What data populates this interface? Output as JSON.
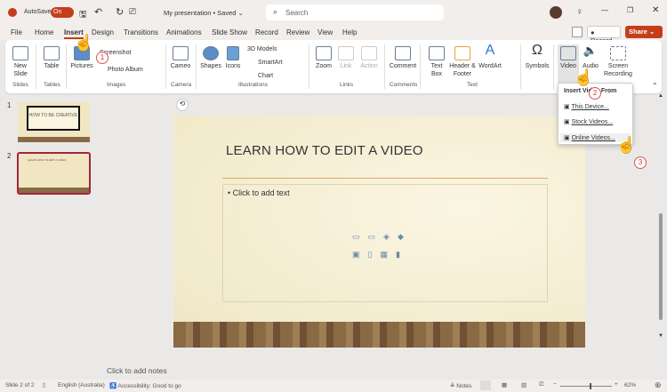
{
  "titlebar": {
    "autosave_label": "AutoSave",
    "autosave_state": "On",
    "doc_title": "My presentation • Saved ⌄",
    "search_placeholder": "Search"
  },
  "tabs": [
    "File",
    "Home",
    "Insert",
    "Design",
    "Transitions",
    "Animations",
    "Slide Show",
    "Record",
    "Review",
    "View",
    "Help"
  ],
  "actions": {
    "record": "Record",
    "share": "Share"
  },
  "ribbon": {
    "new_slide": "New Slide",
    "table": "Table",
    "pictures": "Pictures",
    "screenshot": "Screenshot",
    "photo_album": "Photo Album",
    "cameo": "Cameo",
    "shapes": "Shapes",
    "icons": "Icons",
    "models": "3D Models",
    "smartart": "SmartArt",
    "chart": "Chart",
    "zoom": "Zoom",
    "link": "Link",
    "action": "Action",
    "comment": "Comment",
    "text_box": "Text Box",
    "header_footer": "Header & Footer",
    "wordart": "WordArt",
    "symbols": "Symbols",
    "video": "Video",
    "audio": "Audio",
    "screen_recording": "Screen Recording",
    "groups": {
      "slides": "Slides",
      "tables": "Tables",
      "images": "Images",
      "camera": "Camera",
      "illustrations": "Illustrations",
      "links": "Links",
      "comments": "Comments",
      "text": "Text"
    }
  },
  "video_menu": {
    "header": "Insert Video From",
    "items": [
      "This Device...",
      "Stock Videos...",
      "Online Videos..."
    ]
  },
  "steps": [
    "1",
    "2",
    "3"
  ],
  "thumbnails": [
    {
      "num": "1",
      "title": "HOW TO BE CREATIVE"
    },
    {
      "num": "2",
      "title": "LEARN HOW TO EDIT A VIDEO"
    }
  ],
  "slide": {
    "title": "LEARN HOW TO EDIT A VIDEO",
    "placeholder": "Click to add text"
  },
  "notes": "Click to add notes",
  "status": {
    "slide": "Slide 2 of 2",
    "language": "English (Australia)",
    "accessibility": "Accessibility: Good to go",
    "notes": "Notes",
    "zoom": "62%"
  }
}
